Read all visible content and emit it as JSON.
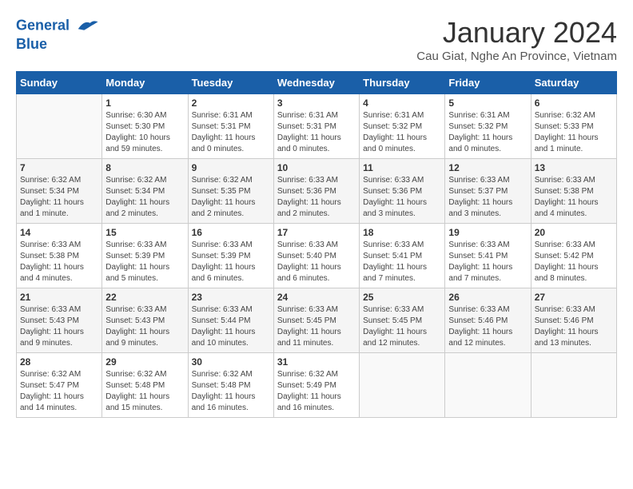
{
  "header": {
    "logo_line1": "General",
    "logo_line2": "Blue",
    "month_title": "January 2024",
    "subtitle": "Cau Giat, Nghe An Province, Vietnam"
  },
  "weekdays": [
    "Sunday",
    "Monday",
    "Tuesday",
    "Wednesday",
    "Thursday",
    "Friday",
    "Saturday"
  ],
  "weeks": [
    [
      {
        "day": "",
        "info": ""
      },
      {
        "day": "1",
        "info": "Sunrise: 6:30 AM\nSunset: 5:30 PM\nDaylight: 10 hours\nand 59 minutes."
      },
      {
        "day": "2",
        "info": "Sunrise: 6:31 AM\nSunset: 5:31 PM\nDaylight: 11 hours\nand 0 minutes."
      },
      {
        "day": "3",
        "info": "Sunrise: 6:31 AM\nSunset: 5:31 PM\nDaylight: 11 hours\nand 0 minutes."
      },
      {
        "day": "4",
        "info": "Sunrise: 6:31 AM\nSunset: 5:32 PM\nDaylight: 11 hours\nand 0 minutes."
      },
      {
        "day": "5",
        "info": "Sunrise: 6:31 AM\nSunset: 5:32 PM\nDaylight: 11 hours\nand 0 minutes."
      },
      {
        "day": "6",
        "info": "Sunrise: 6:32 AM\nSunset: 5:33 PM\nDaylight: 11 hours\nand 1 minute."
      }
    ],
    [
      {
        "day": "7",
        "info": "Sunrise: 6:32 AM\nSunset: 5:34 PM\nDaylight: 11 hours\nand 1 minute."
      },
      {
        "day": "8",
        "info": "Sunrise: 6:32 AM\nSunset: 5:34 PM\nDaylight: 11 hours\nand 2 minutes."
      },
      {
        "day": "9",
        "info": "Sunrise: 6:32 AM\nSunset: 5:35 PM\nDaylight: 11 hours\nand 2 minutes."
      },
      {
        "day": "10",
        "info": "Sunrise: 6:33 AM\nSunset: 5:36 PM\nDaylight: 11 hours\nand 2 minutes."
      },
      {
        "day": "11",
        "info": "Sunrise: 6:33 AM\nSunset: 5:36 PM\nDaylight: 11 hours\nand 3 minutes."
      },
      {
        "day": "12",
        "info": "Sunrise: 6:33 AM\nSunset: 5:37 PM\nDaylight: 11 hours\nand 3 minutes."
      },
      {
        "day": "13",
        "info": "Sunrise: 6:33 AM\nSunset: 5:38 PM\nDaylight: 11 hours\nand 4 minutes."
      }
    ],
    [
      {
        "day": "14",
        "info": "Sunrise: 6:33 AM\nSunset: 5:38 PM\nDaylight: 11 hours\nand 4 minutes."
      },
      {
        "day": "15",
        "info": "Sunrise: 6:33 AM\nSunset: 5:39 PM\nDaylight: 11 hours\nand 5 minutes."
      },
      {
        "day": "16",
        "info": "Sunrise: 6:33 AM\nSunset: 5:39 PM\nDaylight: 11 hours\nand 6 minutes."
      },
      {
        "day": "17",
        "info": "Sunrise: 6:33 AM\nSunset: 5:40 PM\nDaylight: 11 hours\nand 6 minutes."
      },
      {
        "day": "18",
        "info": "Sunrise: 6:33 AM\nSunset: 5:41 PM\nDaylight: 11 hours\nand 7 minutes."
      },
      {
        "day": "19",
        "info": "Sunrise: 6:33 AM\nSunset: 5:41 PM\nDaylight: 11 hours\nand 7 minutes."
      },
      {
        "day": "20",
        "info": "Sunrise: 6:33 AM\nSunset: 5:42 PM\nDaylight: 11 hours\nand 8 minutes."
      }
    ],
    [
      {
        "day": "21",
        "info": "Sunrise: 6:33 AM\nSunset: 5:43 PM\nDaylight: 11 hours\nand 9 minutes."
      },
      {
        "day": "22",
        "info": "Sunrise: 6:33 AM\nSunset: 5:43 PM\nDaylight: 11 hours\nand 9 minutes."
      },
      {
        "day": "23",
        "info": "Sunrise: 6:33 AM\nSunset: 5:44 PM\nDaylight: 11 hours\nand 10 minutes."
      },
      {
        "day": "24",
        "info": "Sunrise: 6:33 AM\nSunset: 5:45 PM\nDaylight: 11 hours\nand 11 minutes."
      },
      {
        "day": "25",
        "info": "Sunrise: 6:33 AM\nSunset: 5:45 PM\nDaylight: 11 hours\nand 12 minutes."
      },
      {
        "day": "26",
        "info": "Sunrise: 6:33 AM\nSunset: 5:46 PM\nDaylight: 11 hours\nand 12 minutes."
      },
      {
        "day": "27",
        "info": "Sunrise: 6:33 AM\nSunset: 5:46 PM\nDaylight: 11 hours\nand 13 minutes."
      }
    ],
    [
      {
        "day": "28",
        "info": "Sunrise: 6:32 AM\nSunset: 5:47 PM\nDaylight: 11 hours\nand 14 minutes."
      },
      {
        "day": "29",
        "info": "Sunrise: 6:32 AM\nSunset: 5:48 PM\nDaylight: 11 hours\nand 15 minutes."
      },
      {
        "day": "30",
        "info": "Sunrise: 6:32 AM\nSunset: 5:48 PM\nDaylight: 11 hours\nand 16 minutes."
      },
      {
        "day": "31",
        "info": "Sunrise: 6:32 AM\nSunset: 5:49 PM\nDaylight: 11 hours\nand 16 minutes."
      },
      {
        "day": "",
        "info": ""
      },
      {
        "day": "",
        "info": ""
      },
      {
        "day": "",
        "info": ""
      }
    ]
  ]
}
